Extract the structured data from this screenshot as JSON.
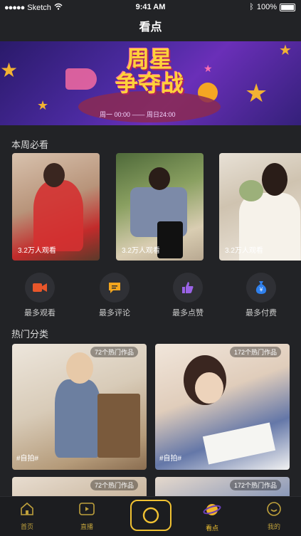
{
  "status_bar": {
    "carrier": "Sketch",
    "time": "9:41 AM",
    "battery": "100%"
  },
  "header": {
    "title": "看点"
  },
  "banner": {
    "headline_line1": "周星",
    "headline_line2": "争夺战",
    "subtitle": "周一 00:00 —— 周日24:00"
  },
  "weekly": {
    "title": "本周必看",
    "cards": [
      {
        "views": "3.2万人观看"
      },
      {
        "views": "3.2万人观看"
      },
      {
        "views": "3.2万人观看"
      }
    ]
  },
  "shortcuts": [
    {
      "label": "最多观看",
      "icon": "video-camera-icon",
      "color": "#e8562a"
    },
    {
      "label": "最多评论",
      "icon": "comment-icon",
      "color": "#f3a51d"
    },
    {
      "label": "最多点赞",
      "icon": "thumbs-up-icon",
      "color": "#9a63e6"
    },
    {
      "label": "最多付费",
      "icon": "money-bag-icon",
      "color": "#2f80ed"
    }
  ],
  "categories": {
    "title": "热门分类",
    "items": [
      {
        "count": "72个热门作品",
        "tag": "#自拍#"
      },
      {
        "count": "172个热门作品",
        "tag": "#自拍#"
      },
      {
        "count": "72个热门作品",
        "tag": ""
      },
      {
        "count": "172个热门作品",
        "tag": ""
      }
    ]
  },
  "tabbar": {
    "items": [
      {
        "label": "首页",
        "icon": "home-icon"
      },
      {
        "label": "直播",
        "icon": "live-play-icon"
      },
      {
        "label": "",
        "icon": "camera-icon"
      },
      {
        "label": "看点",
        "icon": "planet-icon"
      },
      {
        "label": "我的",
        "icon": "smile-icon"
      }
    ]
  }
}
